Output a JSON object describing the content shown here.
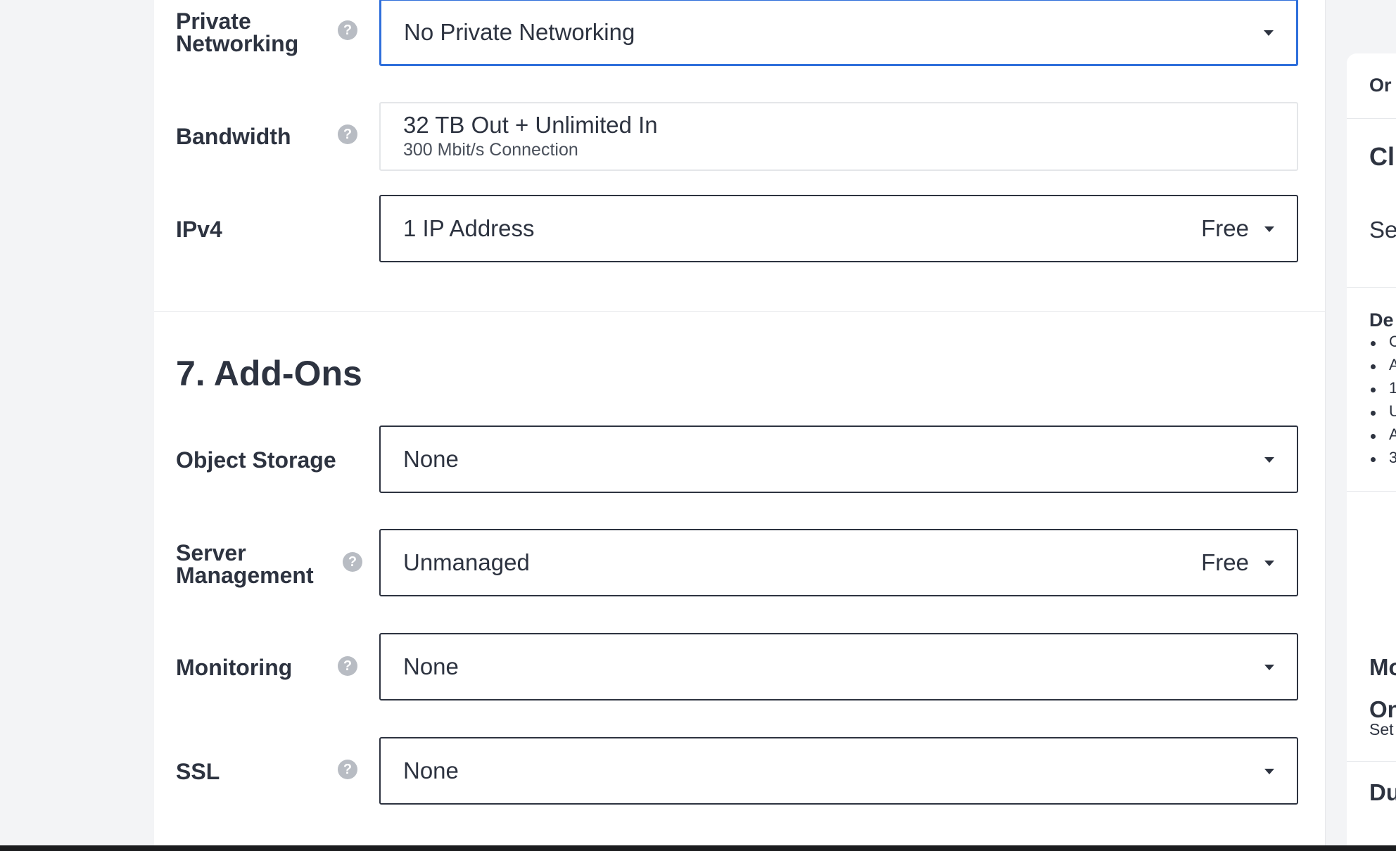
{
  "form": {
    "private_networking": {
      "label": "Private\nNetworking",
      "value": "No Private Networking"
    },
    "bandwidth": {
      "label": "Bandwidth",
      "value": "32 TB Out + Unlimited In",
      "sub": "300 Mbit/s Connection"
    },
    "ipv4": {
      "label": "IPv4",
      "value": "1 IP Address",
      "price": "Free"
    }
  },
  "addons": {
    "title": "7. Add-Ons",
    "object_storage": {
      "label": "Object Storage",
      "value": "None"
    },
    "server_management": {
      "label": "Server\nManagement",
      "value": "Unmanaged",
      "price": "Free"
    },
    "monitoring": {
      "label": "Monitoring",
      "value": "None"
    },
    "ssl": {
      "label": "SSL",
      "value": "None"
    }
  },
  "sidebar": {
    "order_fragment": "Or",
    "heading_fragment": "Cl",
    "select_fragment": "Se",
    "details_fragment": "De",
    "detail_items": [
      "C",
      "A",
      "1",
      "U",
      "A",
      "3"
    ],
    "mo_fragment": "Mo",
    "on_fragment": "On",
    "set_fragment": "Set",
    "du_fragment": "Du"
  },
  "help_icon_glyph": "?"
}
